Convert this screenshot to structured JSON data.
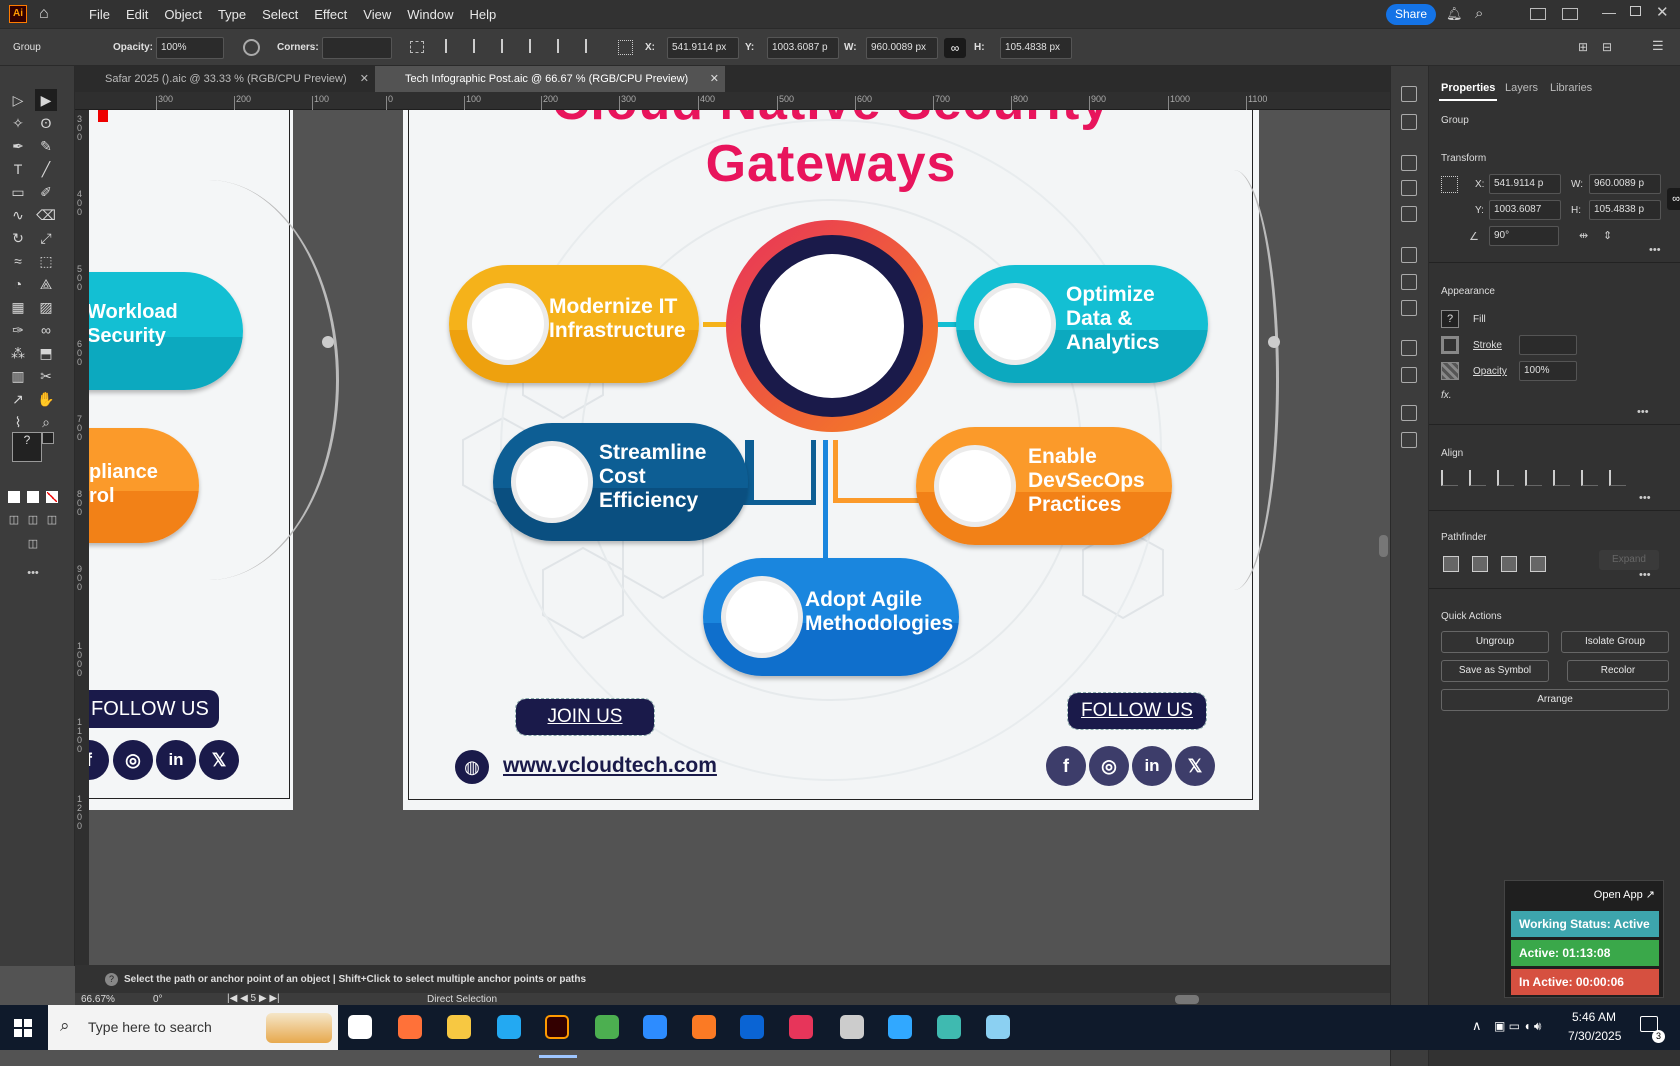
{
  "menubar": {
    "app_icon": "Ai",
    "items": [
      "File",
      "Edit",
      "Object",
      "Type",
      "Select",
      "Effect",
      "View",
      "Window",
      "Help"
    ],
    "share": "Share"
  },
  "control": {
    "selection": "Group",
    "opacity_label": "Opacity:",
    "opacity_value": "100%",
    "corners_label": "Corners:",
    "x_label": "X:",
    "x_value": "541.9114 px",
    "y_label": "Y:",
    "y_value": "1003.6087 p",
    "w_label": "W:",
    "w_value": "960.0089 px",
    "h_label": "H:",
    "h_value": "105.4838 px"
  },
  "tabs": [
    {
      "label": "Safar 2025 ().aic @ 33.33 % (RGB/CPU Preview)"
    },
    {
      "label": "Tech Infographic Post.aic @ 66.67 % (RGB/CPU Preview)"
    }
  ],
  "ruler": {
    "top": [
      "300",
      "200",
      "100",
      "0",
      "100",
      "200",
      "300",
      "400",
      "500",
      "600",
      "700",
      "800",
      "900",
      "1000",
      "1100"
    ],
    "left": [
      "3 0 0",
      "4 0 0",
      "5 0 0",
      "6 0 0",
      "7 0 0",
      "8 0 0",
      "9 0 0",
      "1 0 0 0",
      "1 1 0 0",
      "1 2 0 0"
    ]
  },
  "artboard_left": {
    "pill1": [
      "Workload",
      "Security"
    ],
    "pill2": [
      "pliance",
      "rol"
    ],
    "follow": "FOLLOW US",
    "icons": [
      "instagram-icon",
      "linkedin-icon",
      "x-icon"
    ]
  },
  "artboard": {
    "title_top": "Cloud Native Security",
    "title": "Gateways",
    "pills": [
      {
        "lines": [
          "Modernize IT",
          "Infrastructure"
        ],
        "color_top": "#f5b21a",
        "color_bot": "#eea10e"
      },
      {
        "lines": [
          "Optimize",
          "Data &",
          "Analytics"
        ],
        "color_top": "#13bfd3",
        "color_bot": "#0ca9bf"
      },
      {
        "lines": [
          "Streamline",
          "Cost",
          "Efficiency"
        ],
        "color_top": "#0d5e94",
        "color_bot": "#0a4f80"
      },
      {
        "lines": [
          "Enable",
          "DevSecOps",
          "Practices"
        ],
        "color_top": "#fb9a2a",
        "color_bot": "#f28117"
      },
      {
        "lines": [
          "Adopt Agile",
          "Methodologies"
        ],
        "color_top": "#1a86de",
        "color_bot": "#0f6fcc"
      }
    ],
    "join": "JOIN US",
    "follow": "FOLLOW US",
    "website": "www.vcloudtech.com",
    "social": [
      "facebook-icon",
      "instagram-icon",
      "linkedin-icon",
      "x-icon"
    ],
    "accent": "#e8145c"
  },
  "panel": {
    "tabs": [
      "Properties",
      "Layers",
      "Libraries"
    ],
    "group": "Group",
    "transform": "Transform",
    "x_label": "X:",
    "x": "541.9114 p",
    "y_label": "Y:",
    "y": "1003.6087",
    "w_label": "W:",
    "w": "960.0089 p",
    "h_label": "H:",
    "h": "105.4838 p",
    "angle": "90°",
    "appearance": "Appearance",
    "fill": "Fill",
    "stroke": "Stroke",
    "opacity": "Opacity",
    "opacity_value": "100%",
    "fx": "fx.",
    "align": "Align",
    "pathfinder": "Pathfinder",
    "expand": "Expand",
    "quick_actions": "Quick Actions",
    "buttons": [
      "Ungroup",
      "Isolate Group",
      "Save as Symbol",
      "Recolor",
      "Arrange"
    ]
  },
  "status": {
    "hint": "Select the path or anchor point of an object  |  Shift+Click to select multiple anchor points or paths",
    "zoom": "66.67%",
    "rotate": "0°",
    "artboard_num": "5",
    "tool": "Direct Selection"
  },
  "tracker": {
    "open_app": "Open App ↗",
    "working": "Working Status: Active",
    "active": "Active: 01:13:08",
    "inactive": "In Active: 00:00:06"
  },
  "taskbar": {
    "search": "Type here to search",
    "time": "5:46 AM",
    "date": "7/30/2025",
    "notif": "3"
  }
}
